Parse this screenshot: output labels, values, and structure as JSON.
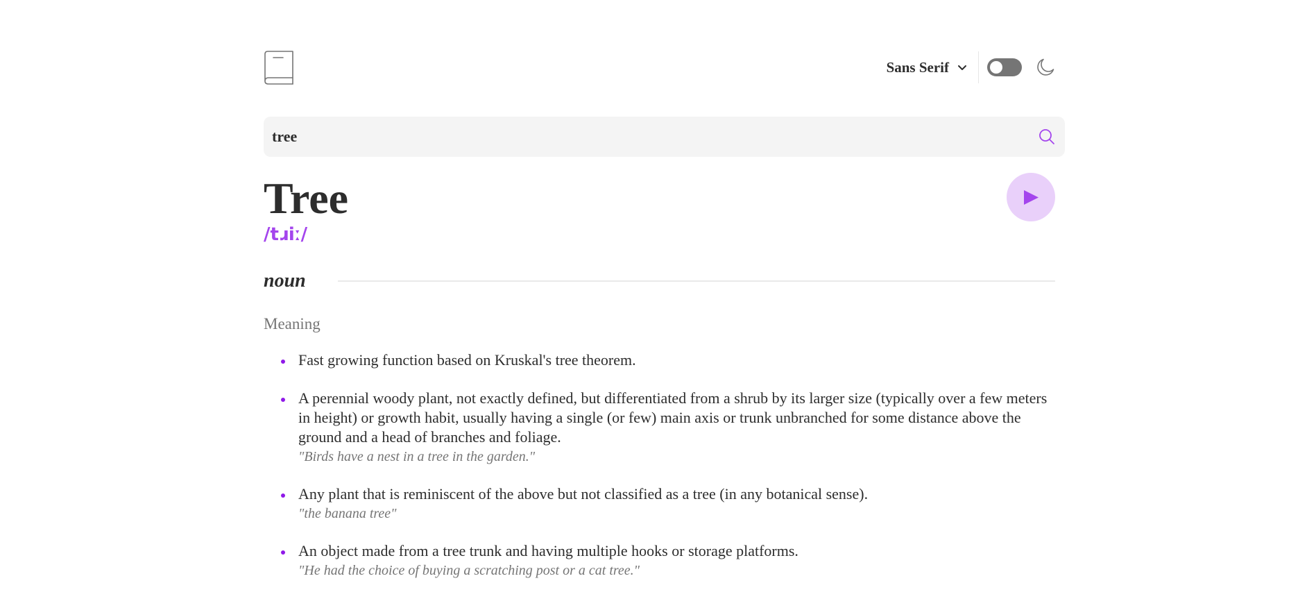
{
  "header": {
    "logo_icon": "book-icon",
    "font_selector": {
      "selected": "Sans Serif",
      "icon": "chevron-down-icon"
    },
    "theme_toggle": {
      "state": "off",
      "icon": "moon-icon"
    }
  },
  "search": {
    "value": "tree",
    "placeholder": "",
    "icon": "search-icon"
  },
  "entry": {
    "word": "Tree",
    "phonetic": "/tɹiː/",
    "play_icon": "play-icon",
    "part_of_speech": "noun",
    "meaning_heading": "Meaning",
    "meanings": [
      {
        "definition": "Fast growing function based on Kruskal's tree theorem.",
        "example": ""
      },
      {
        "definition": "A perennial woody plant, not exactly defined, but differentiated from a shrub by its larger size (typically over a few meters in height) or growth habit, usually having a single (or few) main axis or trunk unbranched for some distance above the ground and a head of branches and foliage.",
        "example": "\"Birds have a nest in a tree in the garden.\""
      },
      {
        "definition": "Any plant that is reminiscent of the above but not classified as a tree (in any botanical sense).",
        "example": "\"the banana tree\""
      },
      {
        "definition": "An object made from a tree trunk and having multiple hooks or storage platforms.",
        "example": "\"He had the choice of buying a scratching post or a cat tree.\""
      }
    ]
  },
  "colors": {
    "accent": "#a445ed",
    "play_bg": "#e9d0fa",
    "search_bg": "#f4f4f4",
    "toggle_bg": "#757575",
    "muted_text": "#757575",
    "text": "#2d2d2d"
  }
}
